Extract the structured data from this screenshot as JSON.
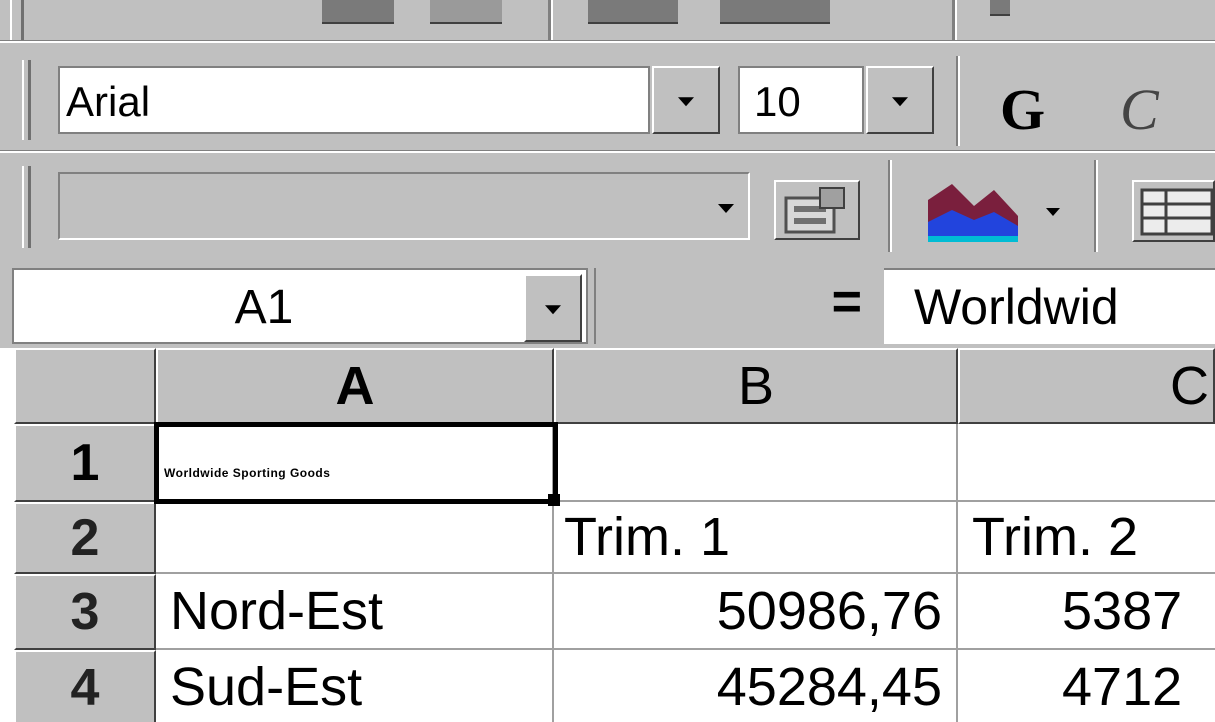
{
  "formatting_toolbar": {
    "font_name": "Arial",
    "font_size": "10",
    "bold_label": "G",
    "italic_label": "C"
  },
  "formula_bar": {
    "name_box": "A1",
    "equals": "=",
    "formula_text": "Worldwid"
  },
  "sheet": {
    "columns": [
      "A",
      "B",
      "C"
    ],
    "rows": [
      {
        "num": "1",
        "a": "Worldwide Sporting Goods",
        "b": "",
        "c": ""
      },
      {
        "num": "2",
        "a": "",
        "b": "Trim. 1",
        "c": "Trim. 2"
      },
      {
        "num": "3",
        "a": "Nord-Est",
        "b": "50986,76",
        "c": "5387"
      },
      {
        "num": "4",
        "a": "Sud-Est",
        "b": "45284,45",
        "c": "4712"
      }
    ],
    "selected_cell": "A1"
  },
  "colors": {
    "chrome": "#c0c0c0",
    "chart_icon_dark": "#7a1f3d",
    "chart_icon_blue": "#2244dd"
  }
}
